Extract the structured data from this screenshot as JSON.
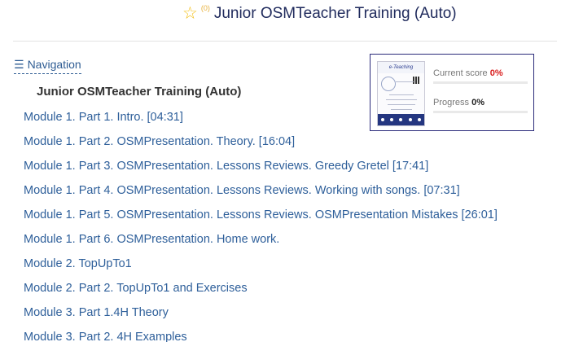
{
  "header": {
    "star_icon": "star-icon",
    "rating_count": "(0)",
    "course_title": "Junior OSMTeacher Training (Auto)"
  },
  "navigation": {
    "toggle_label": "Navigation",
    "heading": "Junior OSMTeacher Training (Auto)",
    "lessons": [
      {
        "label": "Module 1. Part 1. Intro. [04:31]"
      },
      {
        "label": "Module 1. Part 2. OSMPresentation. Theory. [16:04]"
      },
      {
        "label": "Module 1. Part 3. OSMPresentation. Lessons Reviews. Greedy Gretel [17:41]"
      },
      {
        "label": "Module 1. Part 4. OSMPresentation. Lessons Reviews. Working with songs. [07:31]"
      },
      {
        "label": "Module 1. Part 5. OSMPresentation. Lessons Reviews. OSMPresentation Mistakes [26:01]"
      },
      {
        "label": "Module 1. Part 6. OSMPresentation. Home work."
      },
      {
        "label": "Module 2. TopUpTo1"
      },
      {
        "label": "Module 2. Part 2. TopUpTo1 and Exercises"
      },
      {
        "label": "Module 3. Part 1.4H Theory"
      },
      {
        "label": "Module 3. Part 2. 4H Examples"
      }
    ]
  },
  "score_panel": {
    "current_score_label": "Current score",
    "current_score_value": "0%",
    "current_score_fraction": 0,
    "progress_label": "Progress",
    "progress_value": "0%",
    "progress_fraction": 0,
    "thumbnail_header": "e-Teaching"
  },
  "colors": {
    "link": "#2e5f9a",
    "score_accent": "#d92020",
    "panel_border": "#2b2b7a",
    "star": "#f3c019"
  }
}
